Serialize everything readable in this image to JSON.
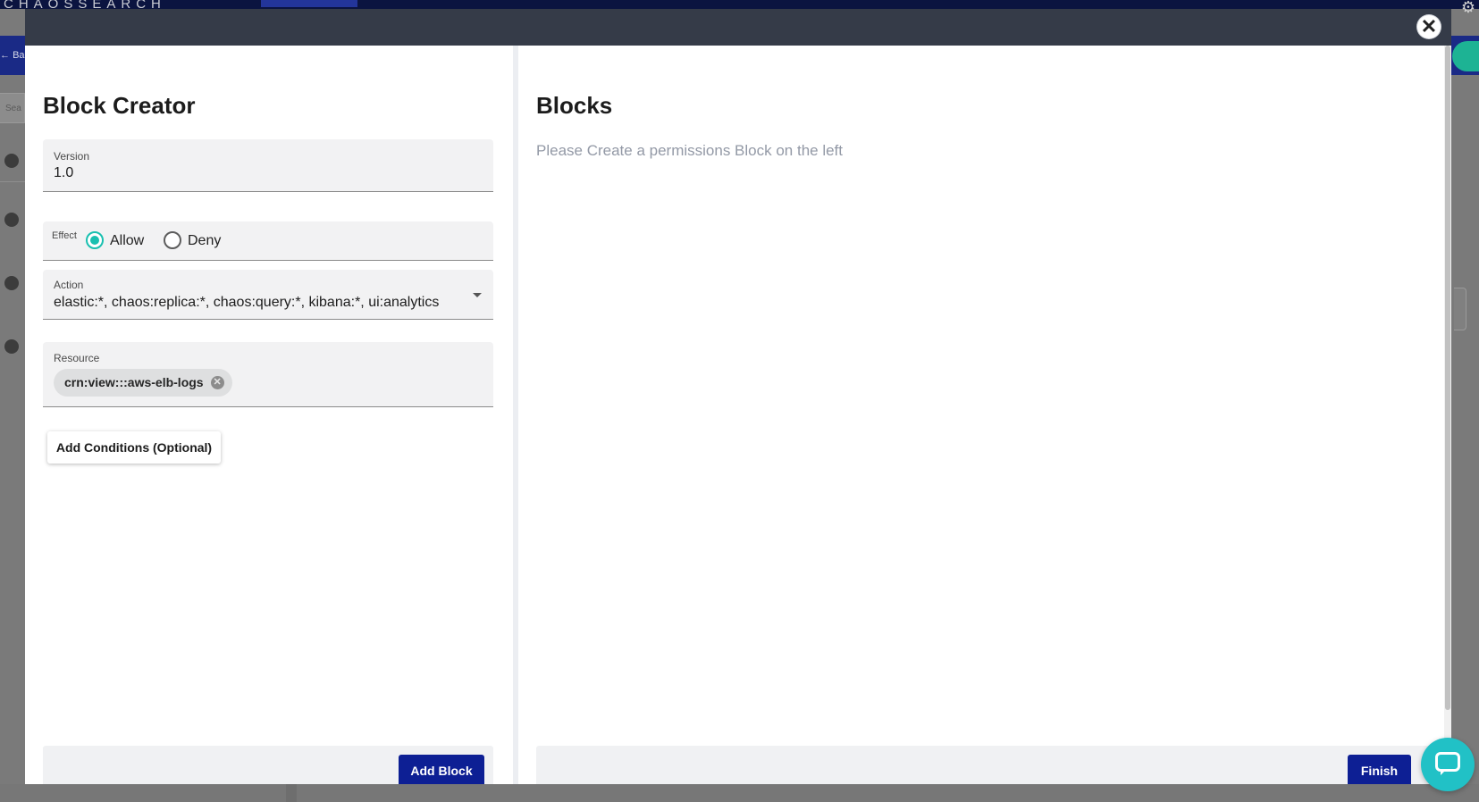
{
  "background": {
    "brand": "CHAOSSEARCH",
    "back_label": "Ba",
    "search_placeholder": "Sea"
  },
  "modal": {
    "close_label": "✕",
    "left": {
      "title": "Block Creator",
      "version": {
        "label": "Version",
        "value": "1.0"
      },
      "effect": {
        "label": "Effect",
        "options": [
          {
            "label": "Allow",
            "selected": true
          },
          {
            "label": "Deny",
            "selected": false
          }
        ]
      },
      "action": {
        "label": "Action",
        "value": "elastic:*, chaos:replica:*, chaos:query:*, kibana:*, ui:analytics"
      },
      "resource": {
        "label": "Resource",
        "chips": [
          "crn:view:::aws-elb-logs"
        ]
      },
      "add_conditions_label": "Add Conditions (Optional)",
      "add_block_label": "Add Block"
    },
    "right": {
      "title": "Blocks",
      "placeholder": "Please Create a permissions Block on the left",
      "finish_label": "Finish"
    }
  },
  "colors": {
    "primary_button": "#0d1f94",
    "radio_selected": "#19c0b0",
    "modal_header": "#353b48",
    "chat_bubble": "#21c1c6"
  },
  "icons": {
    "close": "close-icon",
    "dropdown": "chevron-down-icon",
    "chip_remove": "cancel-circle-icon",
    "chat": "chat-icon",
    "settings": "gear-icon"
  }
}
